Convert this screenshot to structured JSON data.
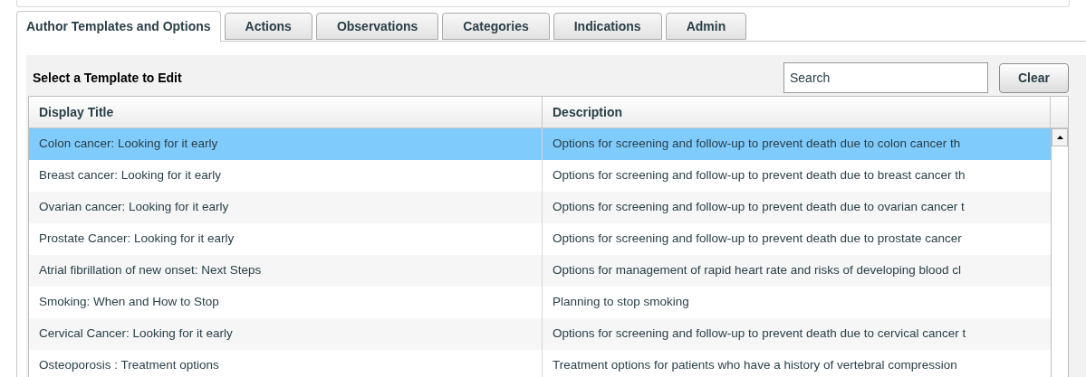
{
  "tabs": [
    {
      "label": "Author Templates and Options",
      "selected": true
    },
    {
      "label": "Actions",
      "selected": false
    },
    {
      "label": "Observations",
      "selected": false
    },
    {
      "label": "Categories",
      "selected": false
    },
    {
      "label": "Indications",
      "selected": false
    },
    {
      "label": "Admin",
      "selected": false
    }
  ],
  "panel": {
    "title": "Select a Template to Edit",
    "search": {
      "placeholder": "Search"
    },
    "clear_button": "Clear"
  },
  "table": {
    "columns": [
      "Display Title",
      "Description"
    ],
    "rows": [
      {
        "selected": true,
        "cells": [
          "Colon cancer: Looking for it early",
          "Options for screening and follow-up to prevent death due to colon cancer th"
        ]
      },
      {
        "selected": false,
        "cells": [
          "Breast cancer: Looking for it early",
          "Options for screening and follow-up to prevent death due to breast cancer th"
        ]
      },
      {
        "selected": false,
        "cells": [
          "Ovarian cancer: Looking for it early",
          "Options for screening and follow-up to prevent death due to ovarian cancer t"
        ]
      },
      {
        "selected": false,
        "cells": [
          "Prostate Cancer: Looking for it early",
          "Options for screening and follow-up to prevent death due to prostate cancer"
        ]
      },
      {
        "selected": false,
        "cells": [
          "Atrial fibrillation of new onset:  Next Steps",
          "Options for management of rapid heart rate and risks of developing blood cl"
        ]
      },
      {
        "selected": false,
        "cells": [
          "Smoking:  When and How to Stop",
          "Planning to stop smoking"
        ]
      },
      {
        "selected": false,
        "cells": [
          "Cervical Cancer: Looking for it early",
          "Options for screening and follow-up to prevent death due to cervical cancer t"
        ]
      },
      {
        "selected": false,
        "cells": [
          "Osteoporosis :  Treatment options",
          "Treatment options for patients who have a history of vertebral compression"
        ]
      }
    ]
  }
}
